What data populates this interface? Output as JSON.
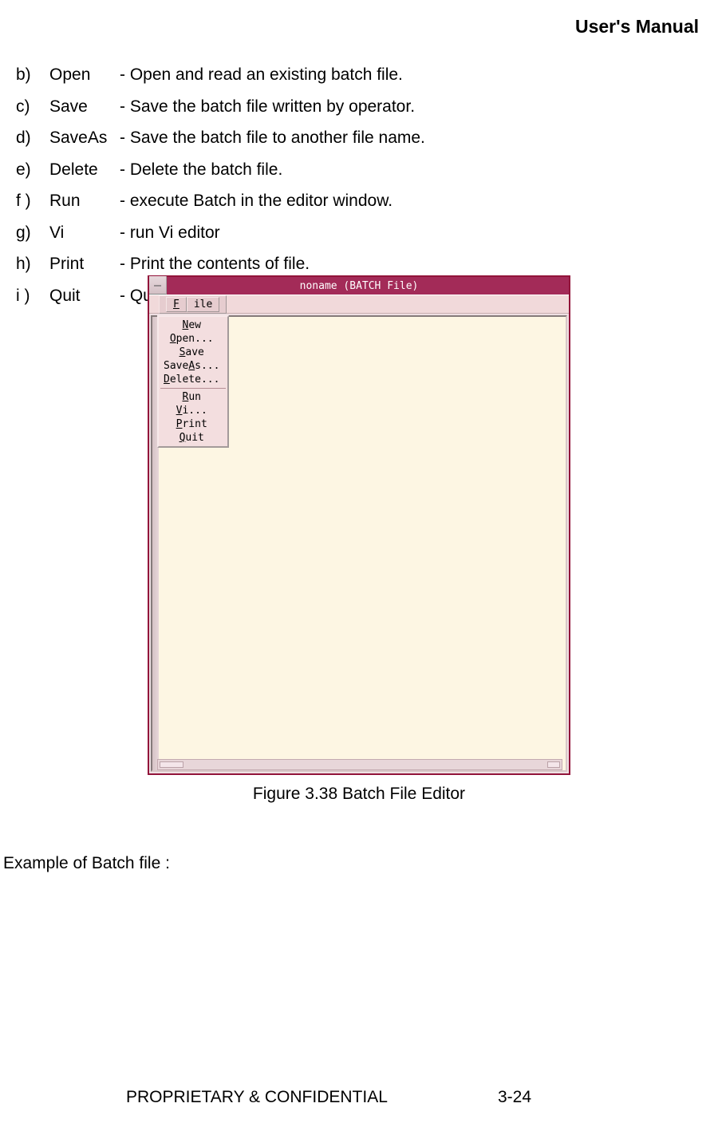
{
  "header": {
    "title": "User's Manual"
  },
  "list": {
    "items": [
      {
        "letter": "b)",
        "cmd": "Open",
        "desc": "- Open and read an existing batch file."
      },
      {
        "letter": "c)",
        "cmd": "Save",
        "desc": "- Save the batch file written by operator."
      },
      {
        "letter": "d)",
        "cmd": "SaveAs",
        "desc": "- Save the batch file to another file name."
      },
      {
        "letter": "e)",
        "cmd": "Delete",
        "desc": "- Delete the batch file."
      },
      {
        "letter": "f )",
        "cmd": "Run",
        "desc": "- execute Batch in the editor window."
      },
      {
        "letter": "g)",
        "cmd": "Vi",
        "desc": "- run Vi editor"
      },
      {
        "letter": "h)",
        "cmd": "Print",
        "desc": "- Print the contents of file."
      },
      {
        "letter": "i )",
        "cmd": "Quit",
        "desc": "- Quit Batch File Editor."
      }
    ]
  },
  "figure": {
    "window_title": "noname (BATCH File)",
    "menubar_label_pre": "F",
    "menubar_label_post": "ile",
    "menu_items": [
      {
        "pre": "N",
        "post": "ew"
      },
      {
        "pre": "O",
        "post": "pen..."
      },
      {
        "pre": "S",
        "post": "ave"
      },
      {
        "pre": "Save",
        "mid": "A",
        "post": "s..."
      },
      {
        "pre": "D",
        "post": "elete..."
      },
      {
        "sep": true
      },
      {
        "pre": "R",
        "post": "un"
      },
      {
        "pre": "V",
        "post": "i..."
      },
      {
        "pre": "P",
        "post": "rint"
      },
      {
        "pre": "Q",
        "post": "uit"
      }
    ],
    "caption": "Figure 3.38 Batch File Editor"
  },
  "example_heading": "Example of Batch file :",
  "footer": {
    "left": "PROPRIETARY & CONFIDENTIAL",
    "right": "3-24"
  }
}
